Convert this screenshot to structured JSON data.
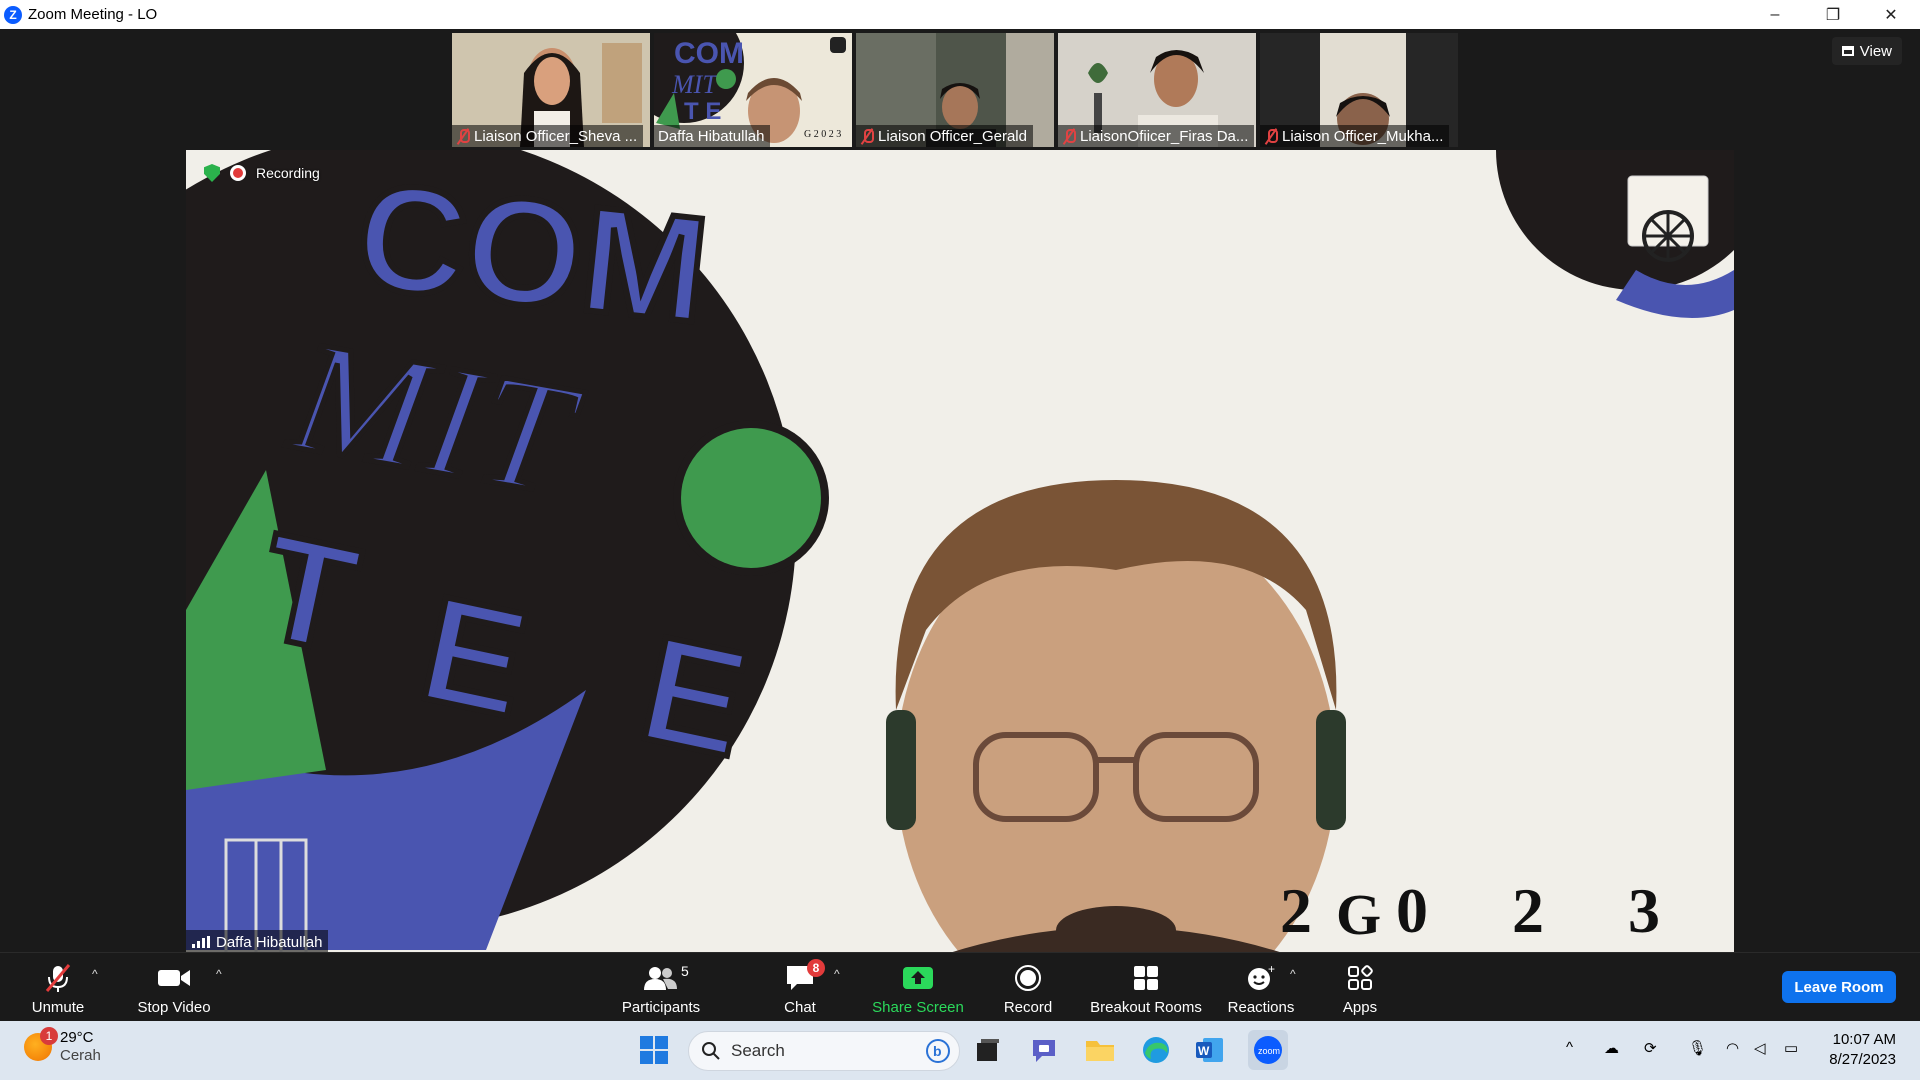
{
  "window": {
    "title": "Zoom Meeting - LO",
    "minimize": "–",
    "restore": "❐",
    "close": "✕"
  },
  "top": {
    "view_label": "View"
  },
  "thumbnails": [
    {
      "name": "Liaison Officer_Sheva ...",
      "muted": true,
      "active": false,
      "bg": "#d9cdb6"
    },
    {
      "name": "Daffa Hibatullah",
      "muted": false,
      "active": true,
      "bg": "#ece7d8"
    },
    {
      "name": "Liaison Officer_Gerald",
      "muted": true,
      "active": false,
      "bg": "#595d52"
    },
    {
      "name": "LiaisonOfiicer_Firas Da...",
      "muted": true,
      "active": false,
      "bg": "#d4d0c8"
    },
    {
      "name": "Liaison Officer_Mukha...",
      "muted": true,
      "active": false,
      "bg": "#2b2b2b"
    }
  ],
  "main": {
    "recording_label": "Recording",
    "speaker_name": "Daffa Hibatullah",
    "background_text": {
      "line1": "COM",
      "line2": "MIT",
      "line3": "T",
      "line4": "E",
      "line5": "E",
      "year": "2 0 2 3",
      "g": "G"
    }
  },
  "toolbar": {
    "unmute": "Unmute",
    "stop_video": "Stop Video",
    "participants": "Participants",
    "participants_count": "5",
    "chat": "Chat",
    "chat_badge": "8",
    "share_screen": "Share Screen",
    "record": "Record",
    "breakout_rooms": "Breakout Rooms",
    "reactions": "Reactions",
    "apps": "Apps",
    "leave": "Leave Room"
  },
  "taskbar": {
    "weather_temp": "29°C",
    "weather_desc": "Cerah",
    "weather_badge": "1",
    "search_placeholder": "Search",
    "time": "10:07 AM",
    "date": "8/27/2023"
  },
  "colors": {
    "accent": "#0e72ed",
    "share_green": "#2bd95b",
    "cobalt": "#4a55b0",
    "green": "#3f9a4e"
  }
}
